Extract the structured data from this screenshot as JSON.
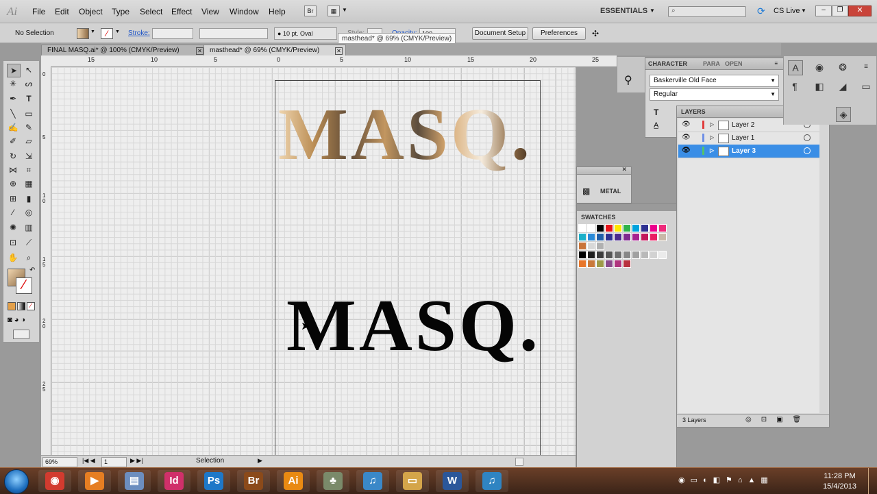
{
  "app": {
    "logo": "Ai",
    "workspace": "ESSENTIALS",
    "search_placeholder": "",
    "cslive": "CS Live"
  },
  "menu": [
    "File",
    "Edit",
    "Object",
    "Type",
    "Select",
    "Effect",
    "View",
    "Window",
    "Help"
  ],
  "controlbar": {
    "selection": "No Selection",
    "stroke_label": "Stroke:",
    "brush": "10 pt. Oval",
    "style_label": "Style:",
    "opacity_label": "Opacity:",
    "opacity_value": "100",
    "document_setup": "Document Setup",
    "preferences": "Preferences",
    "tooltip": "masthead* @ 69% (CMYK/Preview)"
  },
  "tabs": [
    {
      "label": "FINAL MASQ.ai* @ 100% (CMYK/Preview)",
      "active": false
    },
    {
      "label": "masthead* @ 69% (CMYK/Preview)",
      "active": true
    }
  ],
  "ruler_top": [
    "15",
    "10",
    "5",
    "0",
    "5",
    "10",
    "15",
    "20",
    "25"
  ],
  "ruler_left": [
    "0",
    "5",
    "1 0",
    "1 5",
    "2 0",
    "2 5"
  ],
  "artboard": {
    "metal_text": "MASQ.",
    "black_text": "MASQ."
  },
  "statusbar": {
    "zoom": "69%",
    "page": "1",
    "tool": "Selection"
  },
  "character_panel": {
    "tabs": [
      "CHARACTER",
      "PARA",
      "OPEN"
    ],
    "font": "Baskerville Old Face",
    "style": "Regular"
  },
  "layers_panel": {
    "title": "LAYERS",
    "layers": [
      {
        "name": "Layer 2",
        "color": "#e03c3c",
        "selected": false
      },
      {
        "name": "Layer 1",
        "color": "#6f8fe6",
        "selected": false
      },
      {
        "name": "Layer 3",
        "color": "#55c36a",
        "selected": true
      }
    ],
    "count": "3 Layers"
  },
  "metal_panel": {
    "label": "METAL"
  },
  "swatches_panel": {
    "title": "SWATCHES",
    "rows": [
      [
        "#ffffff",
        "#ffffff",
        "#000000",
        "#e8141b",
        "#ffe600",
        "#2fb34a",
        "#00a3dd",
        "#2e3192",
        "#ec008c",
        "#ee2a7b"
      ],
      [
        "#1bb0c9",
        "#2a8ad8",
        "#1f5fa9",
        "#2e3192",
        "#4b2a8c",
        "#7f2a8e",
        "#a6218f",
        "#c2185b",
        "#e91e63",
        "#c8b8a8"
      ],
      [
        "#c9743a",
        "#d8d8d8",
        "#b0b0b0"
      ],
      [
        "#000000",
        "#1e1e1e",
        "#3c3c3c",
        "#555555",
        "#6e6e6e",
        "#878787",
        "#a0a0a0",
        "#b9b9b9",
        "#d2d2d2",
        "#ebebeb"
      ],
      [
        "#e8762a",
        "#c9793a",
        "#9d9a48",
        "#8a4b8c",
        "#b0357e",
        "#b8313e"
      ]
    ]
  },
  "taskbar": {
    "apps": [
      {
        "label": "◉",
        "color": "#d23b2f"
      },
      {
        "label": "▶",
        "color": "#e67e22"
      },
      {
        "label": "▤",
        "color": "#6c8ebf"
      },
      {
        "label": "Id",
        "color": "#d0306a"
      },
      {
        "label": "Ps",
        "color": "#1e78c8"
      },
      {
        "label": "Br",
        "color": "#8b4a1a"
      },
      {
        "label": "Ai",
        "color": "#e98a12"
      },
      {
        "label": "♣",
        "color": "#7a8a6a"
      },
      {
        "label": "♫",
        "color": "#3a88c8"
      },
      {
        "label": "▭",
        "color": "#d4a54a"
      },
      {
        "label": "W",
        "color": "#2b579a"
      },
      {
        "label": "♫",
        "color": "#2f84c2"
      }
    ],
    "time": "11:28 PM",
    "date": "15/4/2013"
  }
}
